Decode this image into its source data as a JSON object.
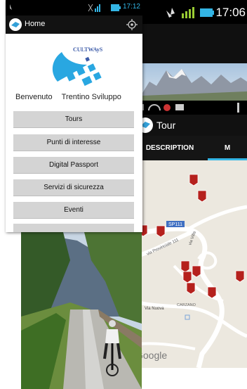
{
  "back_screen": {
    "time": "17:06"
  },
  "tour_screen": {
    "title": "Tour",
    "tabs": [
      {
        "label": "DESCRIPTION"
      },
      {
        "label": "M"
      }
    ],
    "map_labels": {
      "road_tag": "SP111",
      "road_name": "via Provinciale 111",
      "via": "via Villa",
      "via_nuova": "Via Nuova",
      "carzano": "CARZANO",
      "google": "Google"
    }
  },
  "home_screen": {
    "time": "17:12",
    "title": "Home",
    "logo_text": "CULTWAyS",
    "welcome": "Benvenuto",
    "user": "Trentino Sviluppo",
    "menu": [
      {
        "label": "Tours"
      },
      {
        "label": "Punti di interesse"
      },
      {
        "label": "Digital Passport"
      },
      {
        "label": "Servizi di sicurezza"
      },
      {
        "label": "Eventi"
      }
    ]
  }
}
